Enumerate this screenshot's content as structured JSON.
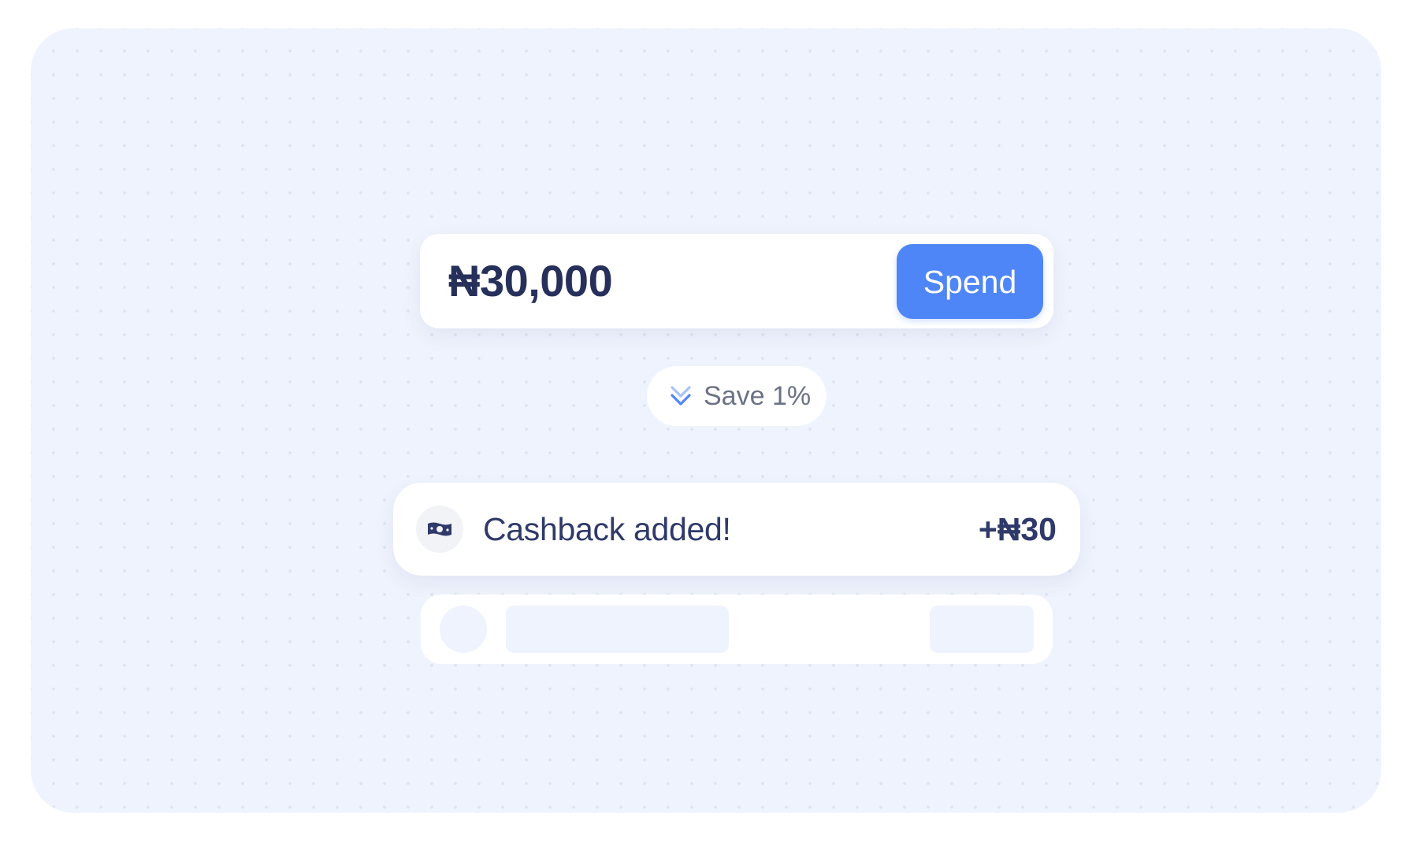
{
  "amount_card": {
    "amount": "₦30,000",
    "spend_label": "Spend"
  },
  "save_pill": {
    "icon": "double-chevron-down-icon",
    "label": "Save 1%"
  },
  "cashback_card": {
    "icon": "banknote-icon",
    "label": "Cashback added!",
    "amount": "+₦30"
  },
  "colors": {
    "accent": "#4f86f7",
    "text_dark": "#27305a",
    "background": "#eff3fd"
  }
}
